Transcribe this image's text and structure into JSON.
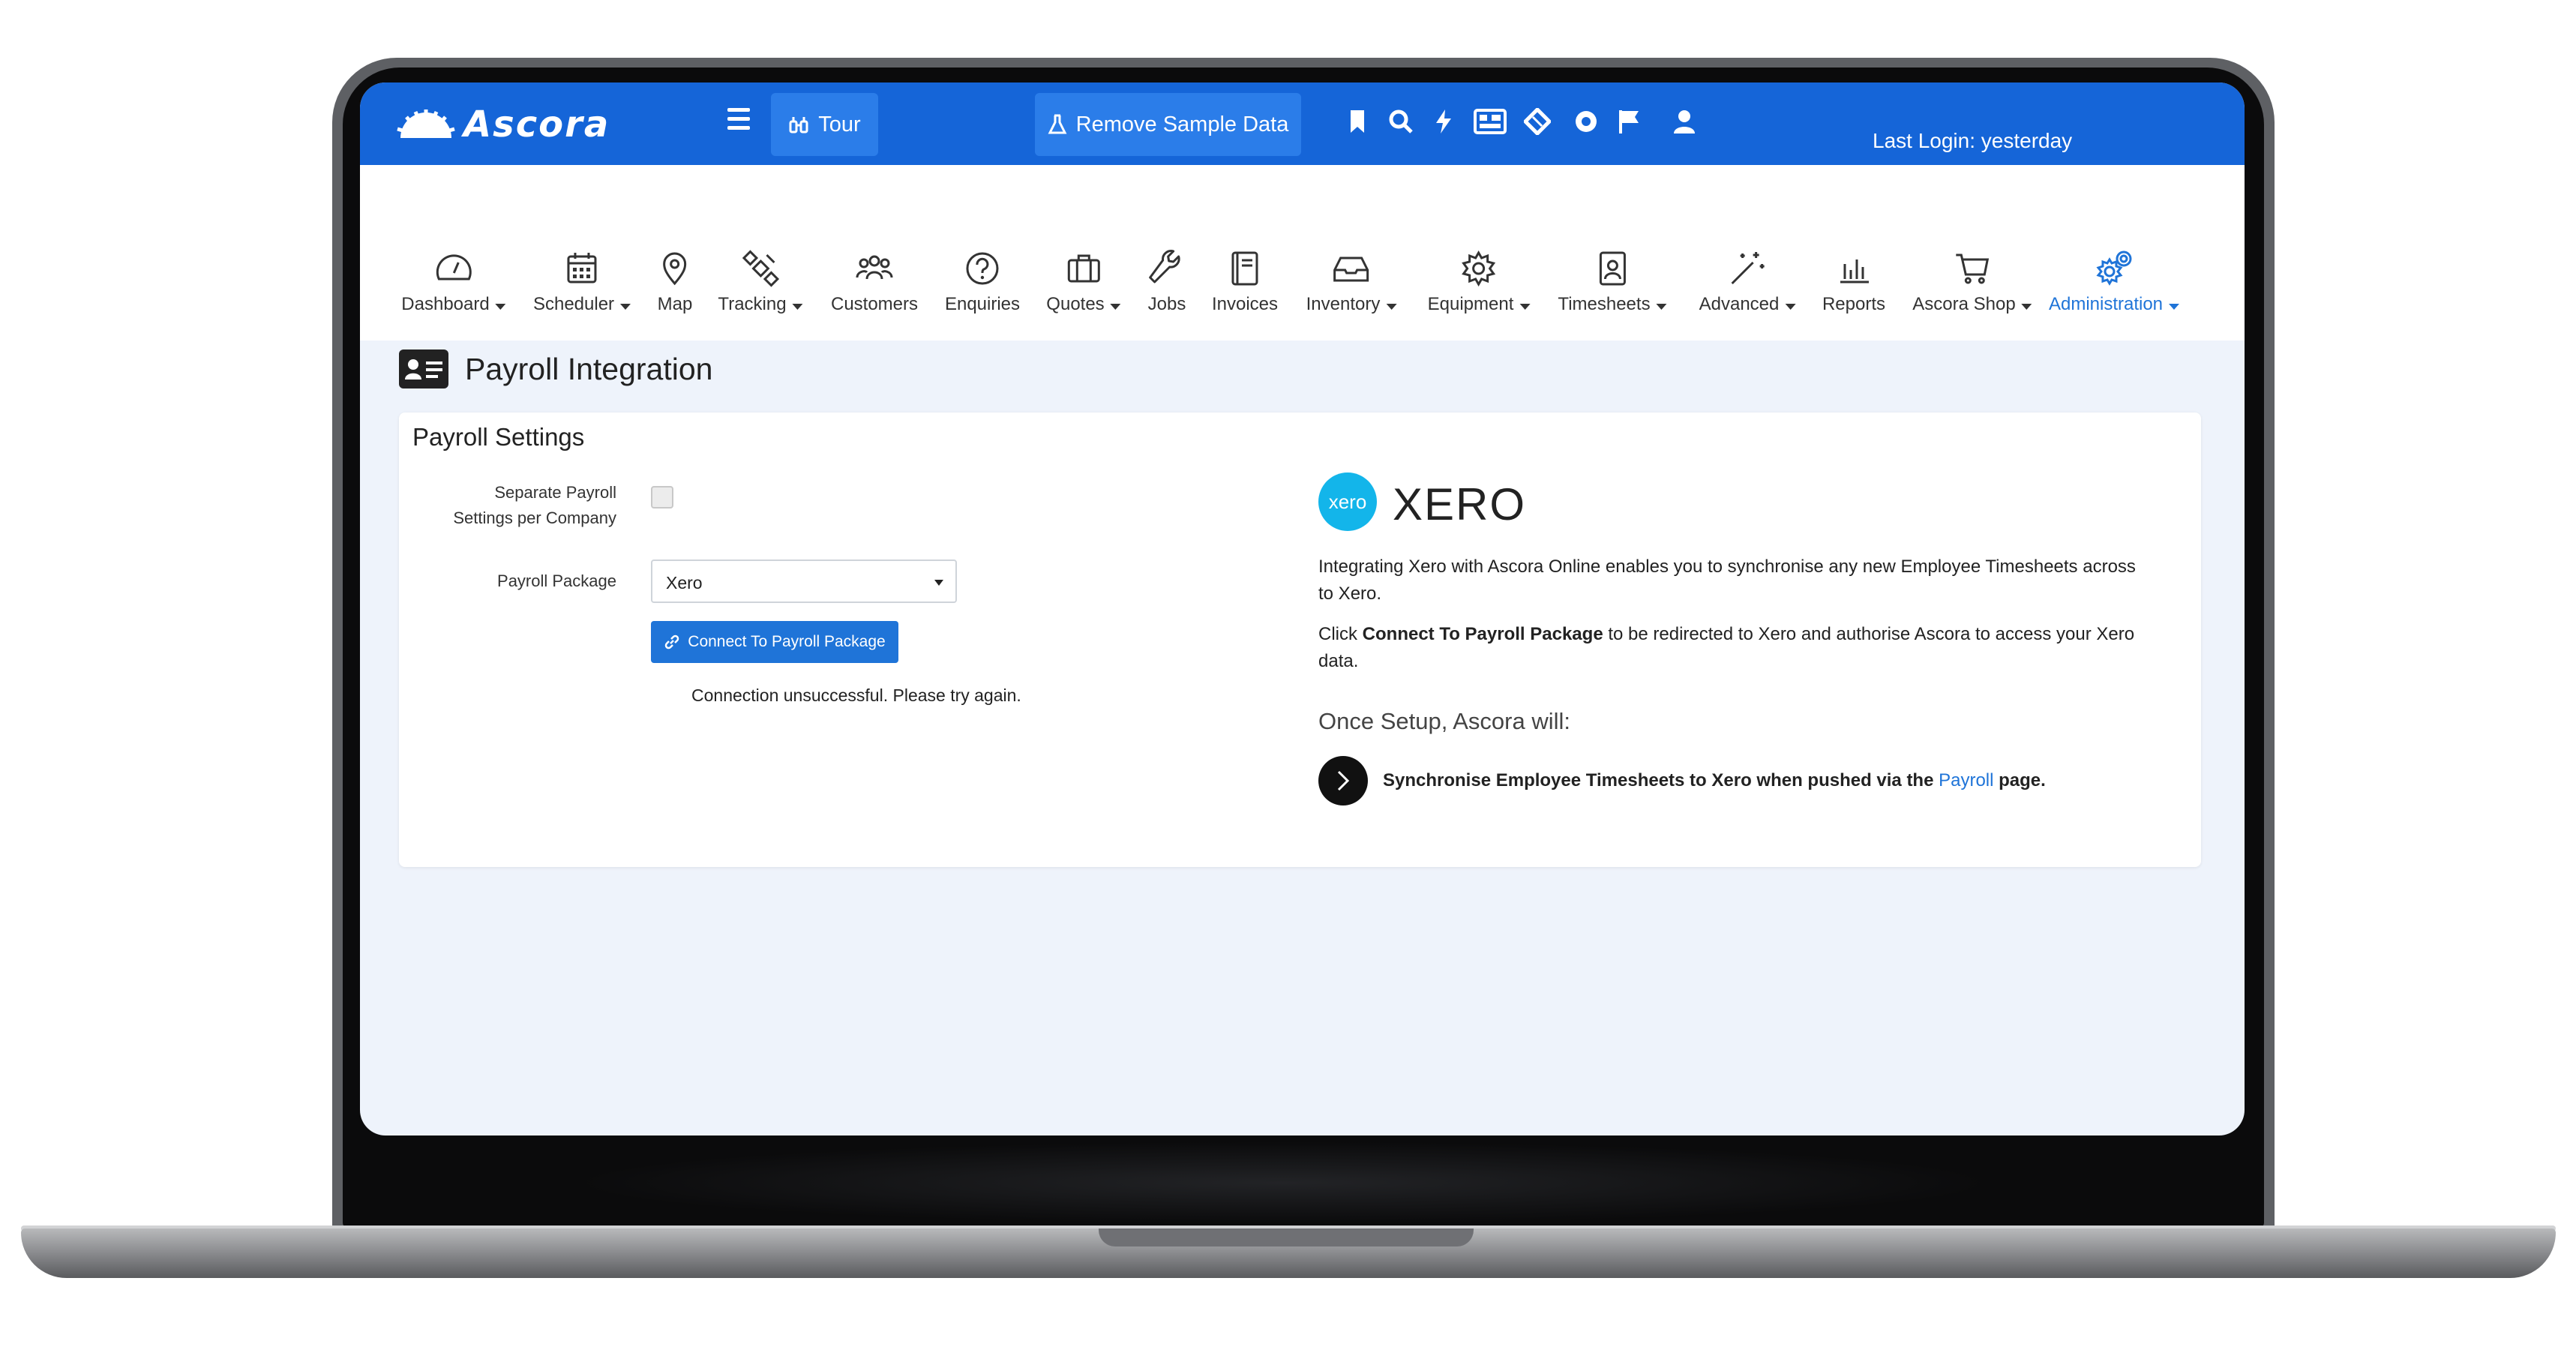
{
  "app": {
    "logo_text": "Ascora"
  },
  "topbar": {
    "tour_label": "Tour",
    "remove_sample_label": "Remove Sample Data",
    "last_login": "Last Login: yesterday",
    "icons": [
      "bookmark-icon",
      "search-icon",
      "bolt-icon",
      "dashboard-grid-icon",
      "ticket-icon",
      "lifebuoy-icon",
      "flag-icon",
      "user-icon"
    ]
  },
  "nav": {
    "items": [
      {
        "label": "Dashboard",
        "icon": "gauge-icon",
        "dropdown": true
      },
      {
        "label": "Scheduler",
        "icon": "calendar-icon",
        "dropdown": true
      },
      {
        "label": "Map",
        "icon": "map-pin-icon",
        "dropdown": false
      },
      {
        "label": "Tracking",
        "icon": "satellite-icon",
        "dropdown": true
      },
      {
        "label": "Customers",
        "icon": "people-icon",
        "dropdown": false
      },
      {
        "label": "Enquiries",
        "icon": "question-icon",
        "dropdown": false
      },
      {
        "label": "Quotes",
        "icon": "briefcase-icon",
        "dropdown": true
      },
      {
        "label": "Jobs",
        "icon": "wrench-icon",
        "dropdown": false
      },
      {
        "label": "Invoices",
        "icon": "book-icon",
        "dropdown": false
      },
      {
        "label": "Inventory",
        "icon": "inbox-icon",
        "dropdown": true
      },
      {
        "label": "Equipment",
        "icon": "gear-icon",
        "dropdown": true
      },
      {
        "label": "Timesheets",
        "icon": "contact-card-icon",
        "dropdown": true
      },
      {
        "label": "Advanced",
        "icon": "magic-wand-icon",
        "dropdown": true
      },
      {
        "label": "Reports",
        "icon": "bar-chart-icon",
        "dropdown": false
      },
      {
        "label": "Ascora Shop",
        "icon": "cart-icon",
        "dropdown": true
      },
      {
        "label": "Administration",
        "icon": "gears-icon",
        "dropdown": true,
        "active": true
      }
    ]
  },
  "page": {
    "title": "Payroll Integration"
  },
  "settings": {
    "card_title": "Payroll Settings",
    "separate_label_1": "Separate Payroll",
    "separate_label_2": "Settings per Company",
    "separate_checked": false,
    "package_label": "Payroll Package",
    "package_value": "Xero",
    "connect_label": "Connect To Payroll Package",
    "connection_message": "Connection unsuccessful. Please try again."
  },
  "xero": {
    "logo_text": "xero",
    "name": "XERO",
    "intro": "Integrating Xero with Ascora Online enables you to synchronise any new Employee Timesheets across to Xero.",
    "click_prefix": "Click ",
    "click_bold": "Connect To Payroll Package",
    "click_suffix": " to be redirected to Xero and authorise Ascora to access your Xero data.",
    "setup_heading": "Once Setup, Ascora will:",
    "sync_text": "Synchronise Employee Timesheets to Xero when pushed via the ",
    "sync_link": "Payroll",
    "sync_end": " page."
  },
  "colors": {
    "brand_blue": "#1565d8",
    "button_blue": "#1f74d8",
    "xero_blue": "#13b5ea"
  }
}
